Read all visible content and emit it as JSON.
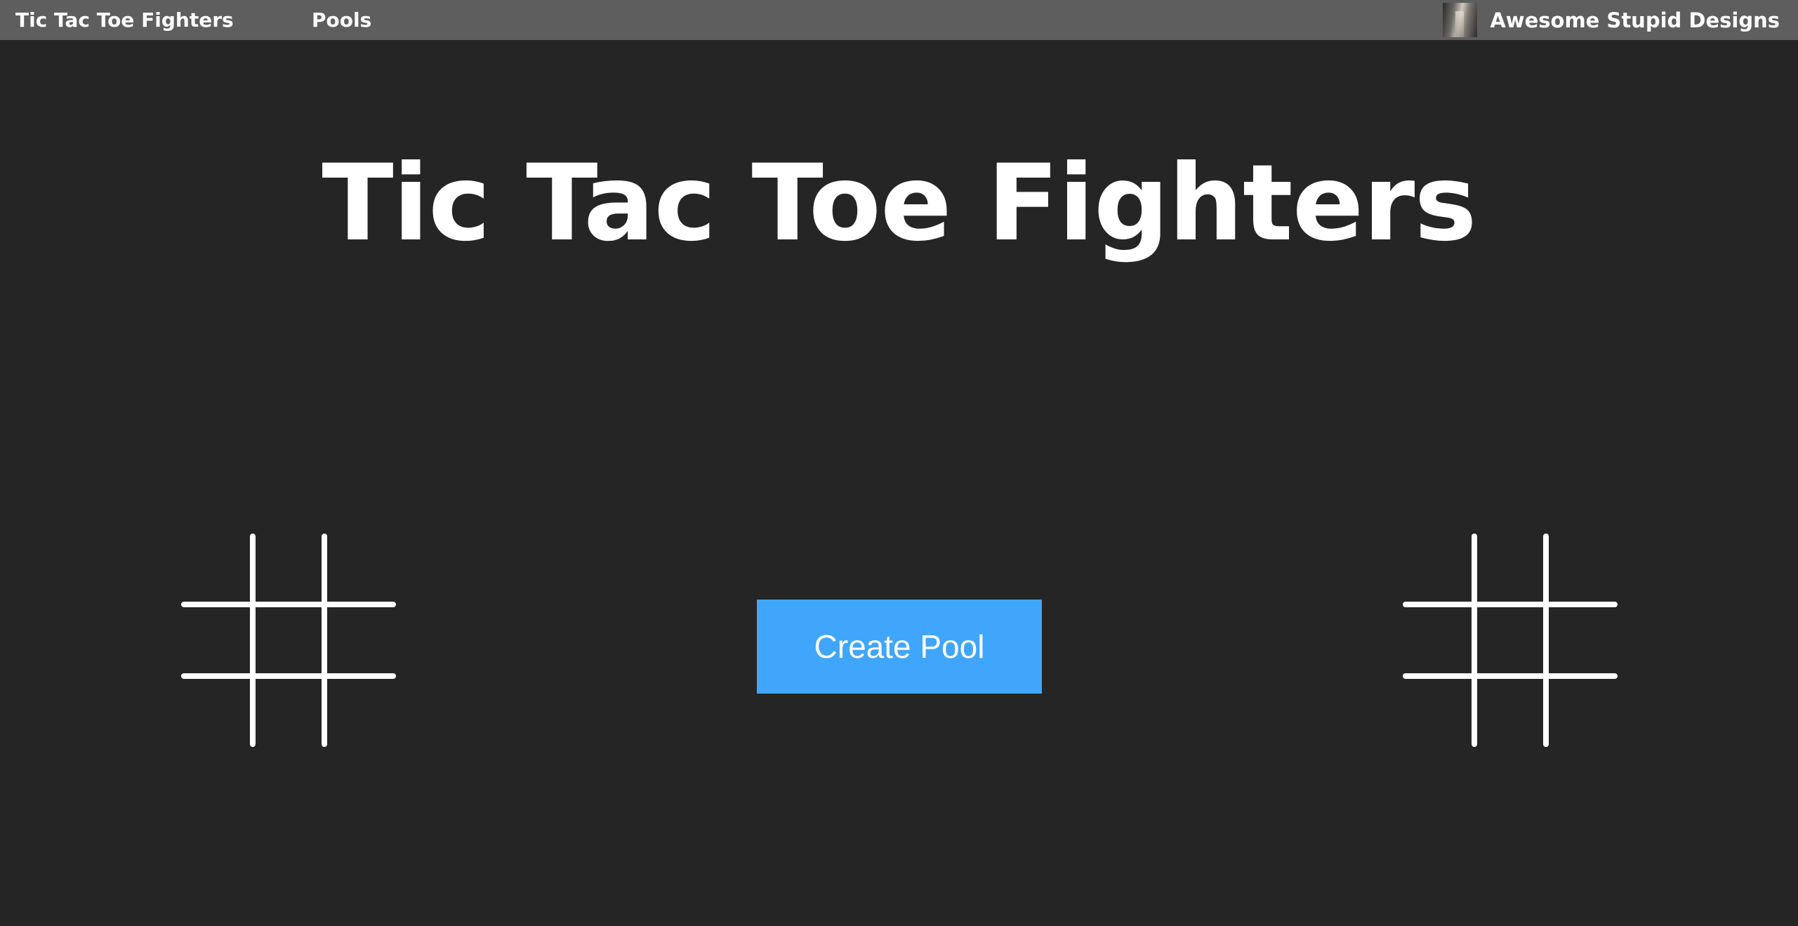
{
  "nav": {
    "brand": "Tic Tac Toe Fighters",
    "pools_link": "Pools",
    "user_name": "Awesome Stupid Designs"
  },
  "main": {
    "title": "Tic Tac Toe Fighters",
    "create_button_label": "Create Pool"
  },
  "colors": {
    "background": "#252525",
    "navbar": "#5e5e5e",
    "accent": "#40a6fc",
    "text": "#ffffff"
  },
  "icons": {
    "decorative_grids": "tic-tac-toe-grid-icon"
  }
}
